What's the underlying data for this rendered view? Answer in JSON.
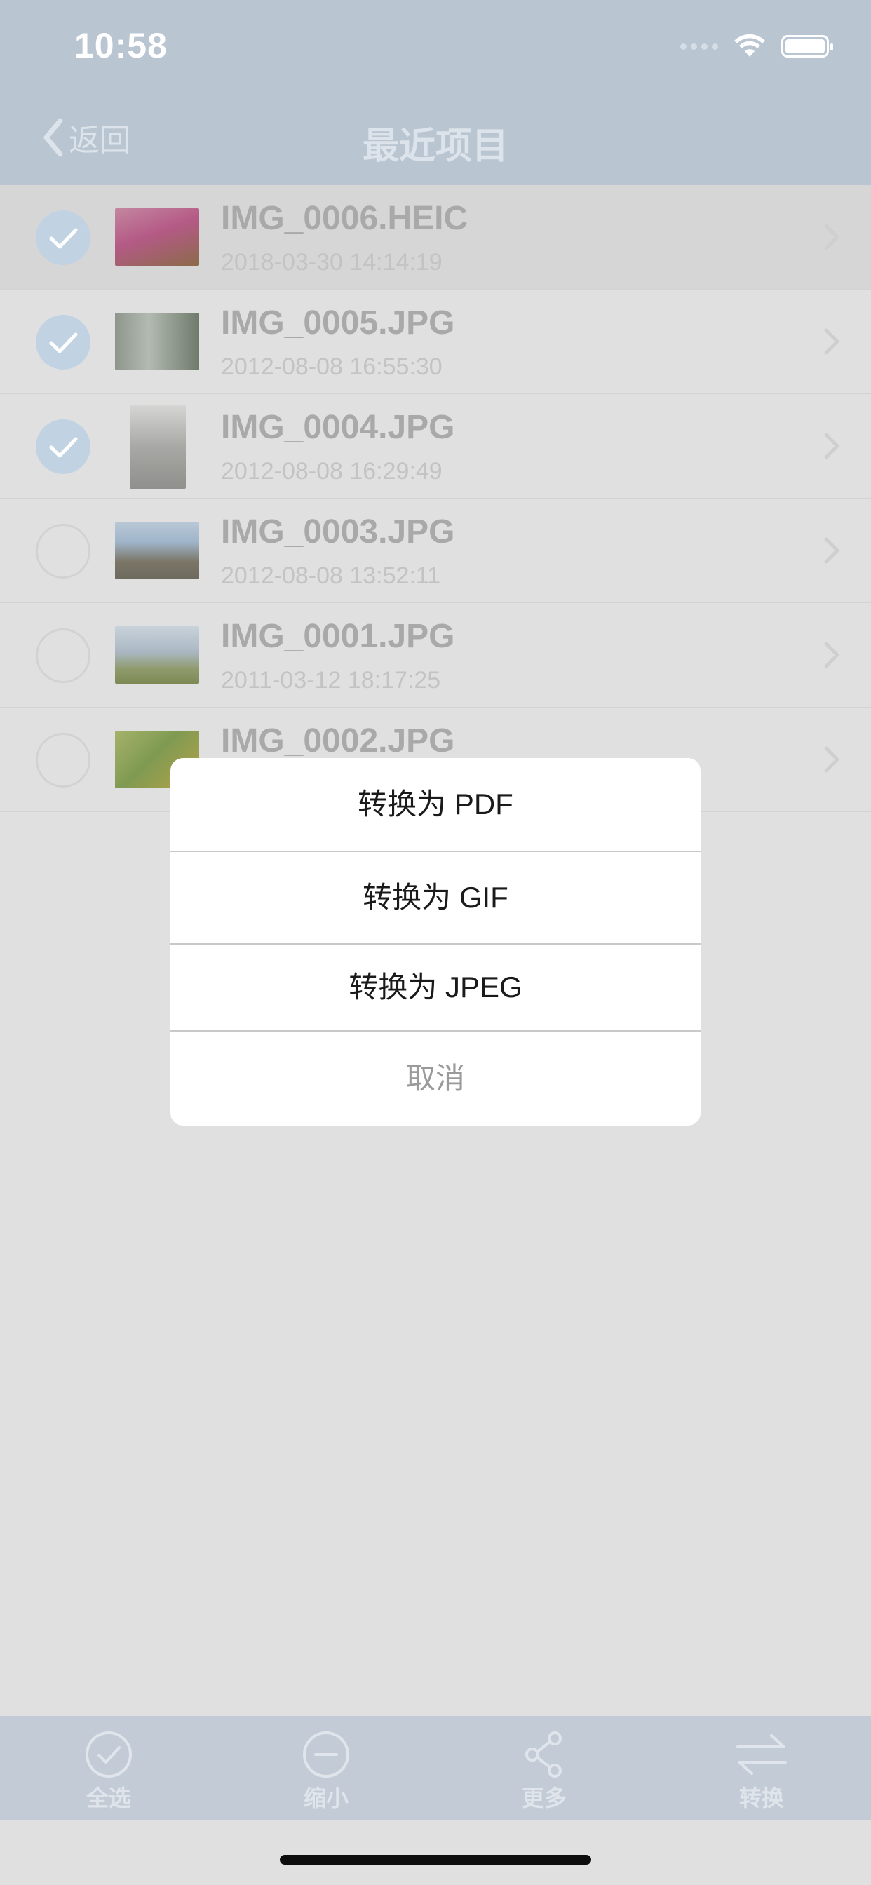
{
  "status_bar": {
    "time": "10:58"
  },
  "nav": {
    "back_label": "返回",
    "title": "最近项目"
  },
  "files": [
    {
      "name": "IMG_0006.HEIC",
      "date": "2018-03-30 14:14:19",
      "selected": true,
      "thumb_colors": [
        "#b45a86",
        "#8c6a4a"
      ]
    },
    {
      "name": "IMG_0005.JPG",
      "date": "2012-08-08 16:55:30",
      "selected": true,
      "thumb_colors": [
        "#9aa39a",
        "#6f7a6b"
      ]
    },
    {
      "name": "IMG_0004.JPG",
      "date": "2012-08-08 16:29:49",
      "selected": true,
      "thumb_colors": [
        "#c2c2c0",
        "#8f8f8c"
      ]
    },
    {
      "name": "IMG_0003.JPG",
      "date": "2012-08-08 13:52:11",
      "selected": false,
      "thumb_colors": [
        "#9fb5c9",
        "#6d6a5e"
      ]
    },
    {
      "name": "IMG_0001.JPG",
      "date": "2011-03-12 18:17:25",
      "selected": false,
      "thumb_colors": [
        "#aab7c2",
        "#7d8a55"
      ]
    },
    {
      "name": "IMG_0002.JPG",
      "date": "",
      "selected": false,
      "thumb_colors": [
        "#7f9a52",
        "#b6a348"
      ]
    }
  ],
  "action_sheet": {
    "options": [
      "转换为 PDF",
      "转换为 GIF",
      "转换为 JPEG"
    ],
    "cancel": "取消"
  },
  "toolbar": {
    "select_all": "全选",
    "shrink": "缩小",
    "more": "更多",
    "convert": "转换"
  },
  "colors": {
    "nav_background": "#b9c5d1",
    "overlay_background": "#e0e0e0",
    "toolbar_background": "#c3ccd6",
    "check_on": "#c1d3e3"
  }
}
